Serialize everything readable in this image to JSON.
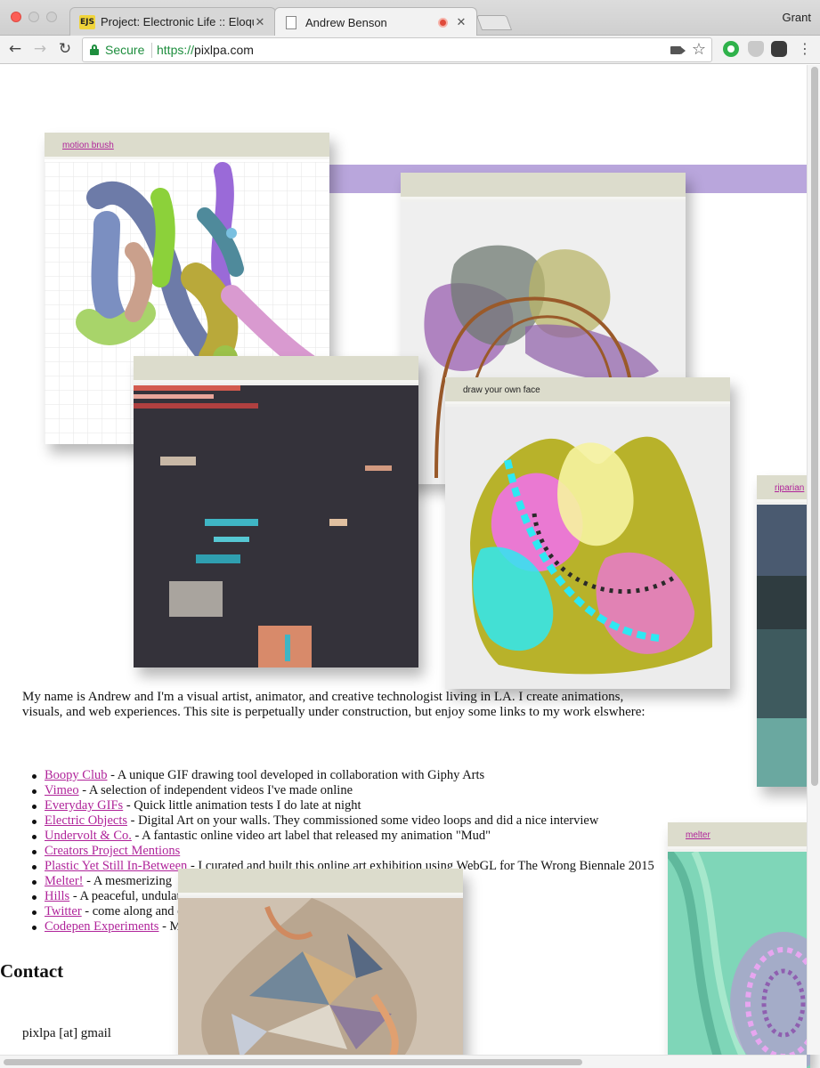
{
  "browser": {
    "tabs": [
      {
        "label": "Project: Electronic Life :: Eloqu",
        "favicon": "EJS"
      },
      {
        "label": "Andrew Benson"
      }
    ],
    "profile": "Grant",
    "secure_label": "Secure",
    "url_scheme": "https://",
    "url_host": "pixlpa.com"
  },
  "cards": {
    "motion_brush": {
      "link": "motion brush"
    },
    "draw_face": {
      "title": "draw your own face"
    },
    "riparian": {
      "link": "riparian"
    },
    "melter": {
      "link": "melter"
    }
  },
  "content": {
    "intro": "My name is Andrew and I'm a visual artist, animator, and creative technologist living in LA. I create animations, visuals, and web experiences. This site is perpetually under construction, but enjoy some links to my work elswhere:",
    "links": [
      {
        "label": "Boopy Club",
        "desc": " - A unique GIF drawing tool developed in collaboration with Giphy Arts"
      },
      {
        "label": "Vimeo",
        "desc": " - A selection of independent videos I've made online"
      },
      {
        "label": "Everyday GIFs",
        "desc": " - Quick little animation tests I do late at night"
      },
      {
        "label": "Electric Objects",
        "desc": " - Digital Art on your walls. They commissioned some video loops and did a nice interview"
      },
      {
        "label": "Undervolt & Co.",
        "desc": " - A fantastic online video art label that released my animation \"Mud\""
      },
      {
        "label": "Creators Project Mentions",
        "desc": ""
      },
      {
        "label": "Plastic Yet Still In-Between",
        "desc": " - I curated and built this online art exhibition using WebGL for The Wrong Biennale 2015"
      },
      {
        "label": "Melter!",
        "desc": " - A mesmerizing"
      },
      {
        "label": "Hills",
        "desc": " - A peaceful, undulat                                                                  walk, built with WebGL."
      },
      {
        "label": "Twitter",
        "desc": " - come along and                                                                 ent and casual encounters."
      },
      {
        "label": "Codepen Experiments",
        "desc": " - M                                                                script animation."
      }
    ],
    "contact_heading": "Contact",
    "contact_email": "pixlpa [at] gmail"
  },
  "colors": {
    "link": "#b0249a",
    "card_header": "#dcdccc",
    "purple_band": "#b9a6dc"
  }
}
